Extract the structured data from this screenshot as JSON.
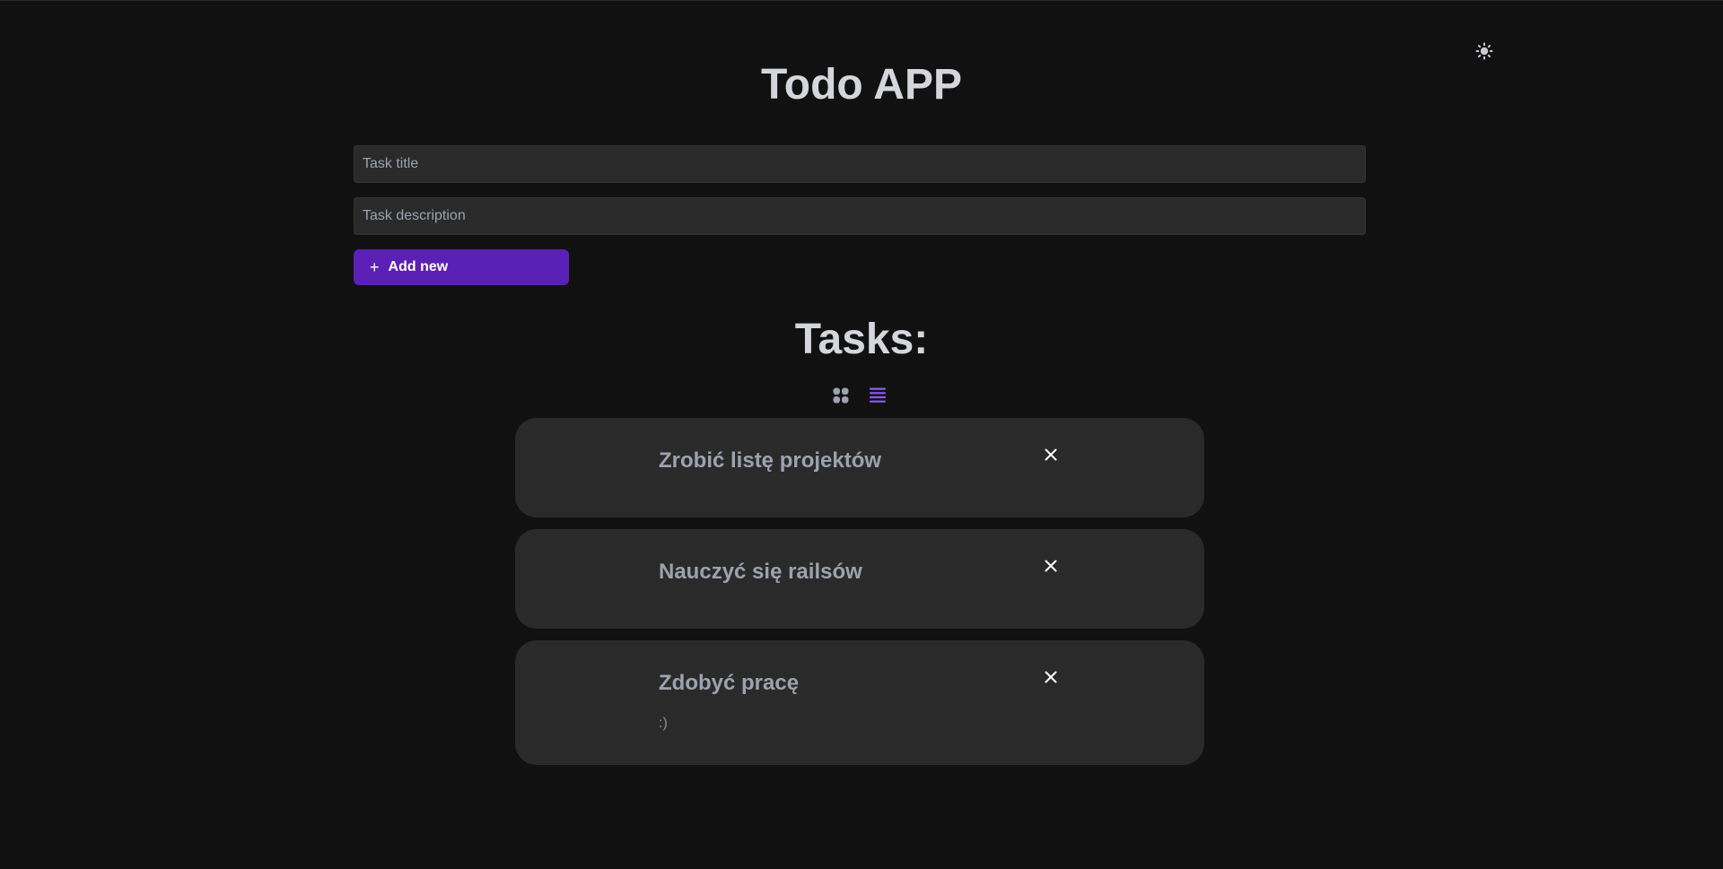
{
  "header": {
    "title": "Todo APP",
    "theme_toggle_icon": "sun-icon"
  },
  "form": {
    "title_placeholder": "Task title",
    "title_value": "",
    "description_placeholder": "Task description",
    "description_value": "",
    "add_button_label": "Add new",
    "add_button_icon": "plus-icon",
    "accent_color": "#5b21b6"
  },
  "tasks_section": {
    "heading": "Tasks:",
    "view_modes": [
      {
        "name": "grid",
        "icon": "grid-view-icon",
        "active": false
      },
      {
        "name": "list",
        "icon": "list-view-icon",
        "active": true
      }
    ],
    "active_color": "#8b5cf6"
  },
  "tasks": [
    {
      "title": "Zrobić listę projektów",
      "description": ""
    },
    {
      "title": "Nauczyć się railsów",
      "description": ""
    },
    {
      "title": "Zdobyć pracę",
      "description": ":)"
    }
  ]
}
